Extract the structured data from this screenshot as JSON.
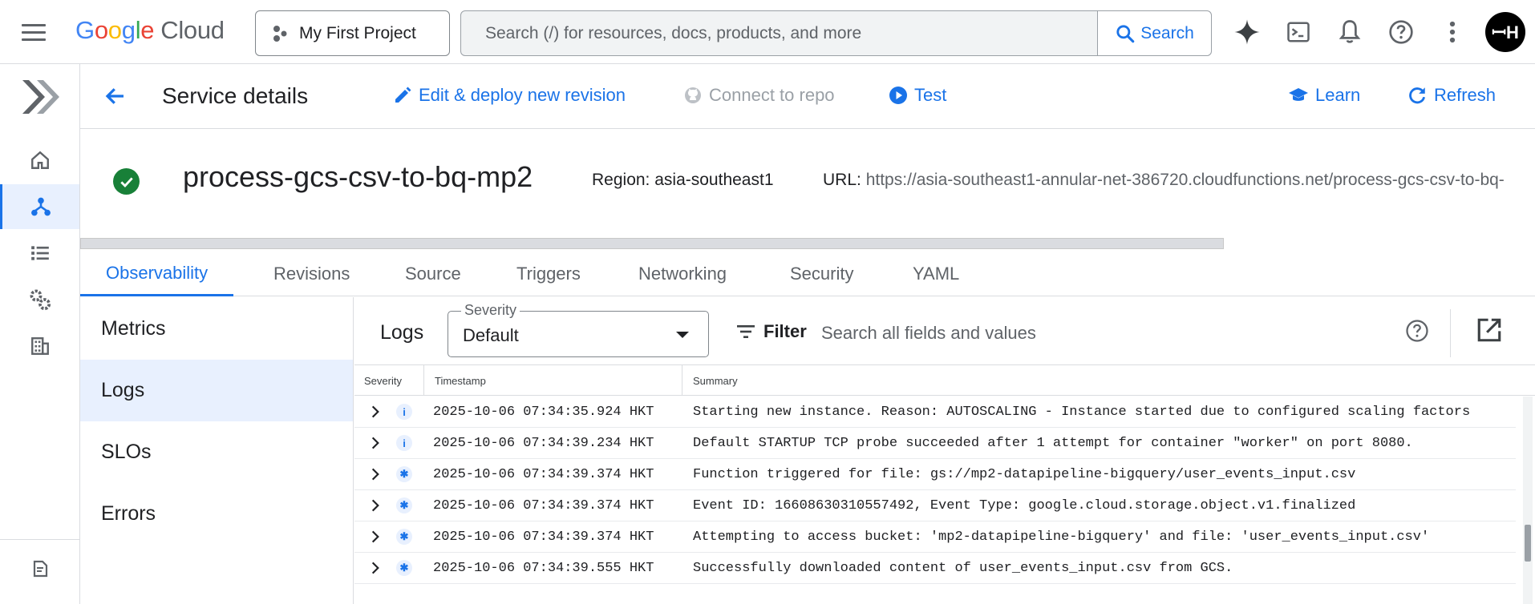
{
  "topbar": {
    "logo_letters": [
      "G",
      "o",
      "o",
      "g",
      "l",
      "e"
    ],
    "logo_suffix": "Cloud",
    "project_name": "My First Project",
    "search_placeholder": "Search (/) for resources, docs, products, and more",
    "search_button": "Search",
    "avatar_initials": "ꟷH"
  },
  "rail": {
    "items": [
      "home-icon",
      "services-icon",
      "list-icon",
      "settings-icon",
      "building-icon",
      "release-notes-icon"
    ],
    "active_item": "services-icon"
  },
  "header": {
    "title": "Service details",
    "actions": {
      "edit": "Edit & deploy new revision",
      "connect": "Connect to repo",
      "test": "Test",
      "learn": "Learn",
      "refresh": "Refresh"
    }
  },
  "service": {
    "name": "process-gcs-csv-to-bq-mp2",
    "status": "ok",
    "region_label": "Region:",
    "region_value": "asia-southeast1",
    "url_label": "URL:",
    "url_value": "https://asia-southeast1-annular-net-386720.cloudfunctions.net/process-gcs-csv-to-bq-"
  },
  "tabs": [
    "Observability",
    "Revisions",
    "Source",
    "Triggers",
    "Networking",
    "Security",
    "YAML"
  ],
  "active_tab": "Observability",
  "subnav": [
    "Metrics",
    "Logs",
    "SLOs",
    "Errors"
  ],
  "active_subnav": "Logs",
  "logs": {
    "title": "Logs",
    "severity_label": "Severity",
    "severity_value": "Default",
    "filter_label": "Filter",
    "filter_placeholder": "Search all fields and values",
    "columns": [
      "Severity",
      "Timestamp",
      "Summary"
    ],
    "rows": [
      {
        "severity": "info",
        "timestamp": "2025-10-06 07:34:35.924 HKT",
        "summary": "Starting new instance. Reason: AUTOSCALING - Instance started due to configured scaling factors"
      },
      {
        "severity": "info",
        "timestamp": "2025-10-06 07:34:39.234 HKT",
        "summary": "Default STARTUP TCP probe succeeded after 1 attempt for container \"worker\" on port 8080."
      },
      {
        "severity": "default",
        "timestamp": "2025-10-06 07:34:39.374 HKT",
        "summary": "Function triggered for file: gs://mp2-datapipeline-bigquery/user_events_input.csv"
      },
      {
        "severity": "default",
        "timestamp": "2025-10-06 07:34:39.374 HKT",
        "summary": "Event ID: 16608630310557492, Event Type: google.cloud.storage.object.v1.finalized"
      },
      {
        "severity": "default",
        "timestamp": "2025-10-06 07:34:39.374 HKT",
        "summary": "Attempting to access bucket: 'mp2-datapipeline-bigquery' and file: 'user_events_input.csv'"
      },
      {
        "severity": "default",
        "timestamp": "2025-10-06 07:34:39.555 HKT",
        "summary": "Successfully downloaded content of user_events_input.csv from GCS."
      }
    ]
  },
  "colors": {
    "accent": "#1a73e8",
    "success": "#188038",
    "active_bg": "#e8f0fe"
  }
}
